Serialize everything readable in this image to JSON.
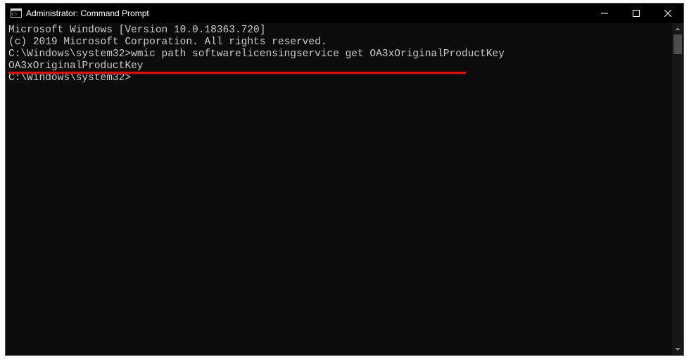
{
  "titlebar": {
    "title": "Administrator: Command Prompt"
  },
  "terminal": {
    "header_line1": "Microsoft Windows [Version 10.0.18363.720]",
    "header_line2": "(c) 2019 Microsoft Corporation. All rights reserved.",
    "blank1": "",
    "prompt1_path": "C:\\Windows\\system32>",
    "command1": "wmic path softwarelicensingservice get OA3xOriginalProductKey",
    "output_header": "OA3xOriginalProductKey",
    "blank2": "",
    "blank3": "",
    "blank4": "",
    "prompt2_path": "C:\\Windows\\system32>"
  }
}
